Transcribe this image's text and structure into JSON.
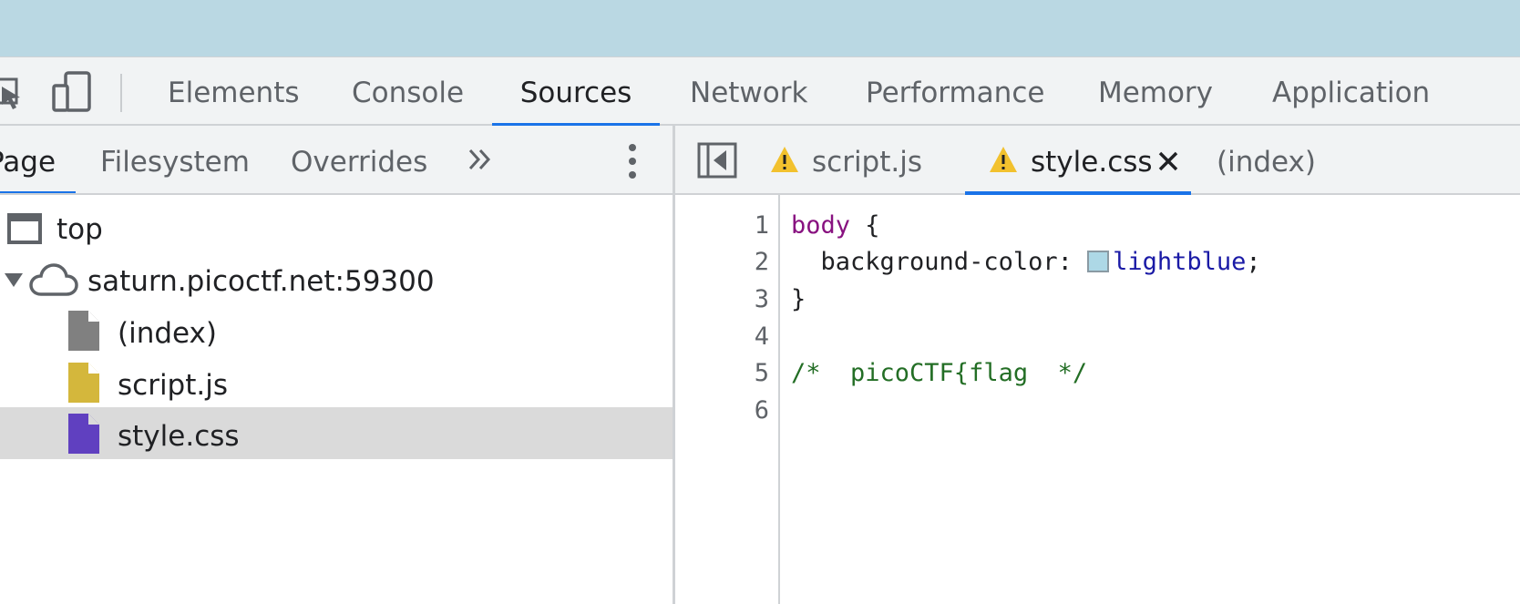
{
  "main_tabs": [
    {
      "label": "Elements"
    },
    {
      "label": "Console"
    },
    {
      "label": "Sources",
      "active": true
    },
    {
      "label": "Network"
    },
    {
      "label": "Performance"
    },
    {
      "label": "Memory"
    },
    {
      "label": "Application"
    }
  ],
  "navigator": {
    "tabs": [
      {
        "label": "Page",
        "active": true
      },
      {
        "label": "Filesystem"
      },
      {
        "label": "Overrides"
      }
    ],
    "more_icon": "double-chevron-right-icon",
    "menu_icon": "kebab-menu-icon",
    "tree": [
      {
        "label": "top",
        "icon": "frame-icon"
      },
      {
        "label": "saturn.picoctf.net:59300",
        "icon": "cloud-icon",
        "expanded": true
      },
      {
        "label": "(index)",
        "icon": "document-icon",
        "color": "#808080"
      },
      {
        "label": "script.js",
        "icon": "document-icon",
        "color": "#d4b73c"
      },
      {
        "label": "style.css",
        "icon": "document-icon",
        "color": "#6040c0",
        "selected": true
      }
    ]
  },
  "editor": {
    "tabs": [
      {
        "label": "script.js",
        "warning": true
      },
      {
        "label": "style.css",
        "warning": true,
        "active": true,
        "closable": true
      },
      {
        "label": "(index)"
      }
    ],
    "line_numbers": [
      "1",
      "2",
      "3",
      "4",
      "5",
      "6"
    ],
    "code": {
      "line1_selector": "body",
      "line1_brace": " {",
      "line2_property": "  background-color: ",
      "line2_swatch_color": "#add8e6",
      "line2_value": "lightblue",
      "line2_semicolon": ";",
      "line3": "}",
      "line5_comment": "/*  picoCTF{flag  */"
    }
  },
  "colors": {
    "page_background": "#bad8e3",
    "accent": "#1a73e8",
    "warning": "#f2c12e"
  }
}
